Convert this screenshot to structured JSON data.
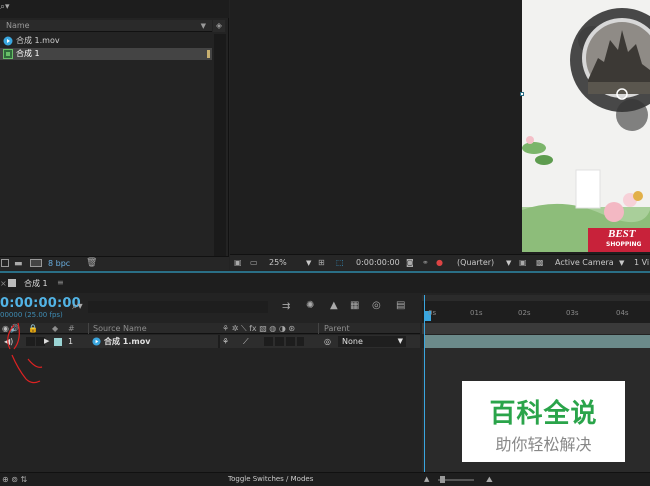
{
  "project": {
    "column_name": "Name",
    "items": [
      {
        "label": "合成 1.mov",
        "type": "video"
      },
      {
        "label": "合成 1",
        "type": "comp",
        "selected": true
      }
    ],
    "bpc": "8 bpc"
  },
  "viewer": {
    "zoom": "25%",
    "timecode": "0:00:00:00",
    "resolution": "(Quarter)",
    "camera": "Active Camera",
    "views": "1 Vi"
  },
  "timeline": {
    "tab_label": "合成 1",
    "timecode": "0:00:00:00",
    "fps": "00000 (25.00 fps)",
    "columns": {
      "number": "#",
      "source_name": "Source Name",
      "parent": "Parent"
    },
    "layer": {
      "number": "1",
      "name": "合成 1.mov",
      "parent": "None"
    },
    "ruler_ticks": [
      "0s",
      "01s",
      "02s",
      "03s",
      "04s"
    ],
    "footer_label": "Toggle Switches / Modes"
  },
  "canvas_text": {
    "badge_line1": "BEST",
    "badge_line2": "SHOPPING"
  },
  "watermark": {
    "line1": "百科全说",
    "line2": "助你轻松解决"
  },
  "colors": {
    "accent": "#52b4e6",
    "panel_border": "#2a6f86",
    "watermark_green": "#2aa44a"
  }
}
